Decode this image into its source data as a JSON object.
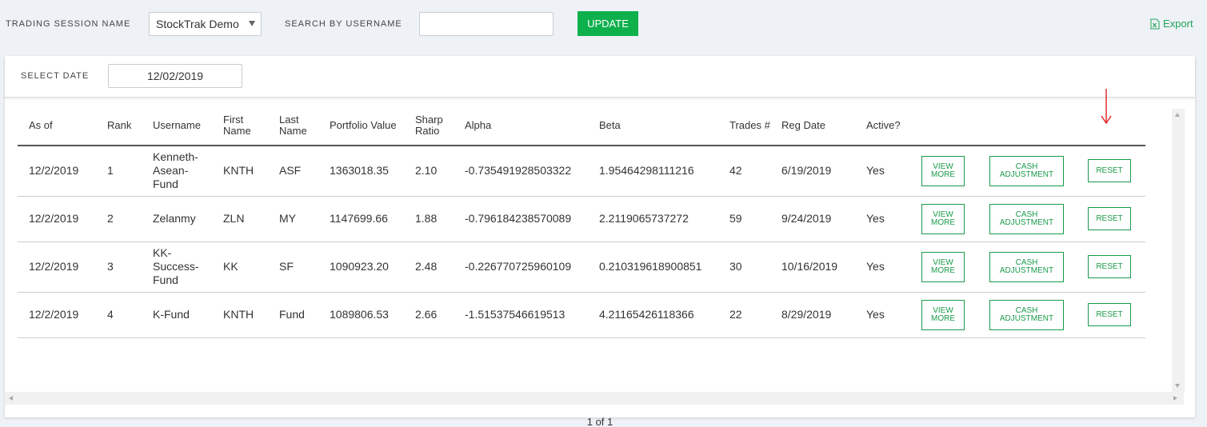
{
  "header": {
    "trading_session_label": "TRADING SESSION NAME",
    "trading_session_value": "StockTrak Demo Class",
    "search_label": "SEARCH BY USERNAME",
    "search_value": "",
    "update_label": "UPDATE",
    "export_label": "Export"
  },
  "filters": {
    "select_date_label": "SELECT DATE",
    "select_date_value": "12/02/2019"
  },
  "table": {
    "columns": {
      "as_of": "As of",
      "rank": "Rank",
      "username": "Username",
      "first_name": "First Name",
      "last_name": "Last Name",
      "portfolio_value": "Portfolio Value",
      "sharp_ratio": "Sharp Ratio",
      "alpha": "Alpha",
      "beta": "Beta",
      "trades": "Trades #",
      "reg_date": "Reg Date",
      "active": "Active?"
    },
    "rows": [
      {
        "as_of": "12/2/2019",
        "rank": "1",
        "username": "Kenneth-Asean-Fund",
        "first_name": "KNTH",
        "last_name": "ASF",
        "portfolio_value": "1363018.35",
        "sharp_ratio": "2.10",
        "alpha": "-0.735491928503322",
        "beta": "1.95464298111216",
        "trades": "42",
        "reg_date": "6/19/2019",
        "active": "Yes"
      },
      {
        "as_of": "12/2/2019",
        "rank": "2",
        "username": "Zelanmy",
        "first_name": "ZLN",
        "last_name": "MY",
        "portfolio_value": "1147699.66",
        "sharp_ratio": "1.88",
        "alpha": "-0.796184238570089",
        "beta": "2.2119065737272",
        "trades": "59",
        "reg_date": "9/24/2019",
        "active": "Yes"
      },
      {
        "as_of": "12/2/2019",
        "rank": "3",
        "username": "KK-Success-Fund",
        "first_name": "KK",
        "last_name": "SF",
        "portfolio_value": "1090923.20",
        "sharp_ratio": "2.48",
        "alpha": "-0.226770725960109",
        "beta": "0.210319618900851",
        "trades": "30",
        "reg_date": "10/16/2019",
        "active": "Yes"
      },
      {
        "as_of": "12/2/2019",
        "rank": "4",
        "username": "K-Fund",
        "first_name": "KNTH",
        "last_name": "Fund",
        "portfolio_value": "1089806.53",
        "sharp_ratio": "2.66",
        "alpha": "-1.51537546619513",
        "beta": "4.21165426118366",
        "trades": "22",
        "reg_date": "8/29/2019",
        "active": "Yes"
      }
    ],
    "actions": {
      "view_more": "VIEW MORE",
      "cash_adjustment": "CASH ADJUSTMENT",
      "reset": "RESET"
    }
  },
  "pagination": {
    "text": "1 of 1"
  },
  "colors": {
    "accent_green": "#0eb04c",
    "annotation_red": "#e02020"
  },
  "icons": {
    "export": "excel-file-icon",
    "annotation": "red-arrow-down-icon"
  }
}
